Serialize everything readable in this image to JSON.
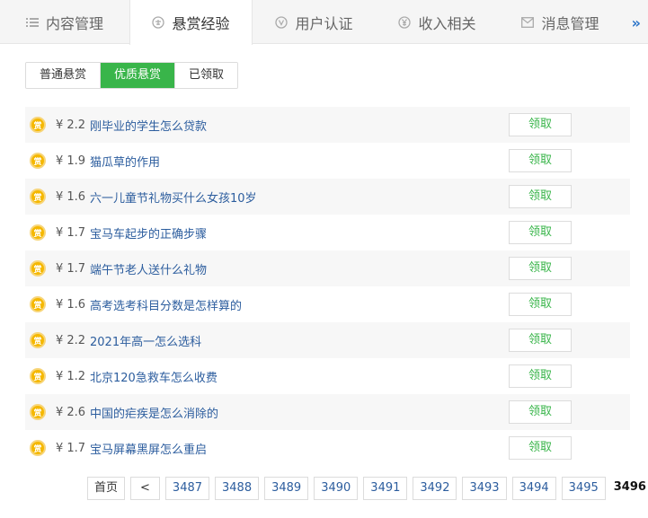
{
  "nav": {
    "tabs": [
      {
        "label": "内容管理",
        "icon": "list-icon"
      },
      {
        "label": "悬赏经验",
        "icon": "reward-icon",
        "active": true
      },
      {
        "label": "用户认证",
        "icon": "verify-icon"
      },
      {
        "label": "收入相关",
        "icon": "yen-icon"
      },
      {
        "label": "消息管理",
        "icon": "mail-icon"
      }
    ],
    "more": "»"
  },
  "subtabs": [
    {
      "label": "普通悬赏"
    },
    {
      "label": "优质悬赏",
      "active": true
    },
    {
      "label": "已领取"
    }
  ],
  "coin_glyph": "赏",
  "claim_label": "领取",
  "items": [
    {
      "amount": "¥ 2.2",
      "question": "刚毕业的学生怎么贷款"
    },
    {
      "amount": "¥ 1.9",
      "question": "猫瓜草的作用"
    },
    {
      "amount": "¥ 1.6",
      "question": "六一儿童节礼物买什么女孩10岁"
    },
    {
      "amount": "¥ 1.7",
      "question": "宝马车起步的正确步骤"
    },
    {
      "amount": "¥ 1.7",
      "question": "端午节老人送什么礼物"
    },
    {
      "amount": "¥ 1.6",
      "question": "高考选考科目分数是怎样算的"
    },
    {
      "amount": "¥ 2.2",
      "question": "2021年高一怎么选科"
    },
    {
      "amount": "¥ 1.2",
      "question": "北京120急救车怎么收费"
    },
    {
      "amount": "¥ 2.6",
      "question": "中国的疟疾是怎么消除的"
    },
    {
      "amount": "¥ 1.7",
      "question": "宝马屏幕黑屏怎么重启"
    }
  ],
  "pager": {
    "first": "首页",
    "prev": "<",
    "pages": [
      "3487",
      "3488",
      "3489",
      "3490",
      "3491",
      "3492",
      "3493",
      "3494",
      "3495"
    ],
    "current": "3496"
  },
  "colors": {
    "accent_green": "#39b54a",
    "link_blue": "#2c5d9e",
    "coin_gold": "#f5b800"
  }
}
